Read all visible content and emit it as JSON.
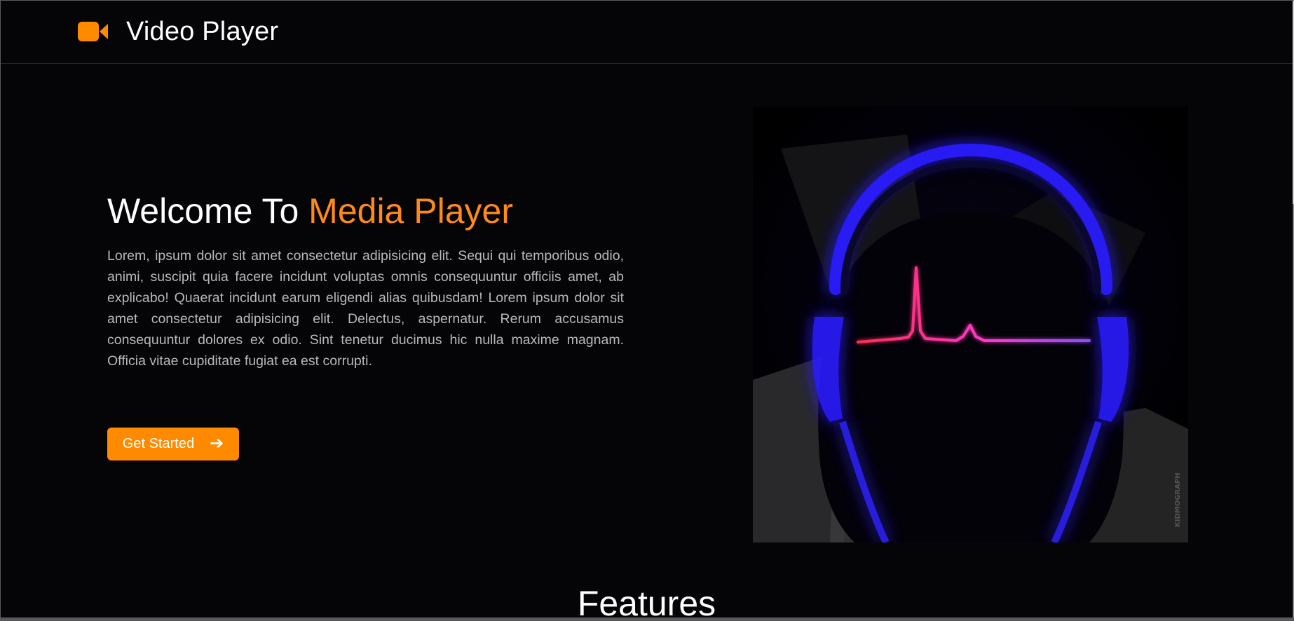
{
  "nav": {
    "brand_title": "Video Player",
    "brand_icon": "video-camera-icon"
  },
  "hero": {
    "title_prefix": "Welcome To ",
    "title_accent": "Media Player",
    "body": "Lorem, ipsum dolor sit amet consectetur adipisicing elit. Sequi qui temporibus odio, animi, suscipit quia facere incidunt voluptas omnis consequuntur officiis amet, ab explicabo! Quaerat incidunt earum eligendi alias quibusdam! Lorem ipsum dolor sit amet consectetur adipisicing elit. Delectus, aspernatur. Rerum accusamus consequuntur dolores ex odio. Sint tenetur ducimus hic nulla maxime magnam. Officia vitae cupiditate fugiat ea est corrupti.",
    "cta_label": "Get Started",
    "cta_icon": "arrow-right-icon",
    "image_watermark": "KIDMOGRAPH"
  },
  "features": {
    "title": "Features"
  },
  "colors": {
    "accent": "#ff8a00",
    "background": "#050406",
    "headphone_glow": "#2e20ff",
    "pulse_start": "#ff2d55",
    "pulse_end": "#8d4dff"
  }
}
